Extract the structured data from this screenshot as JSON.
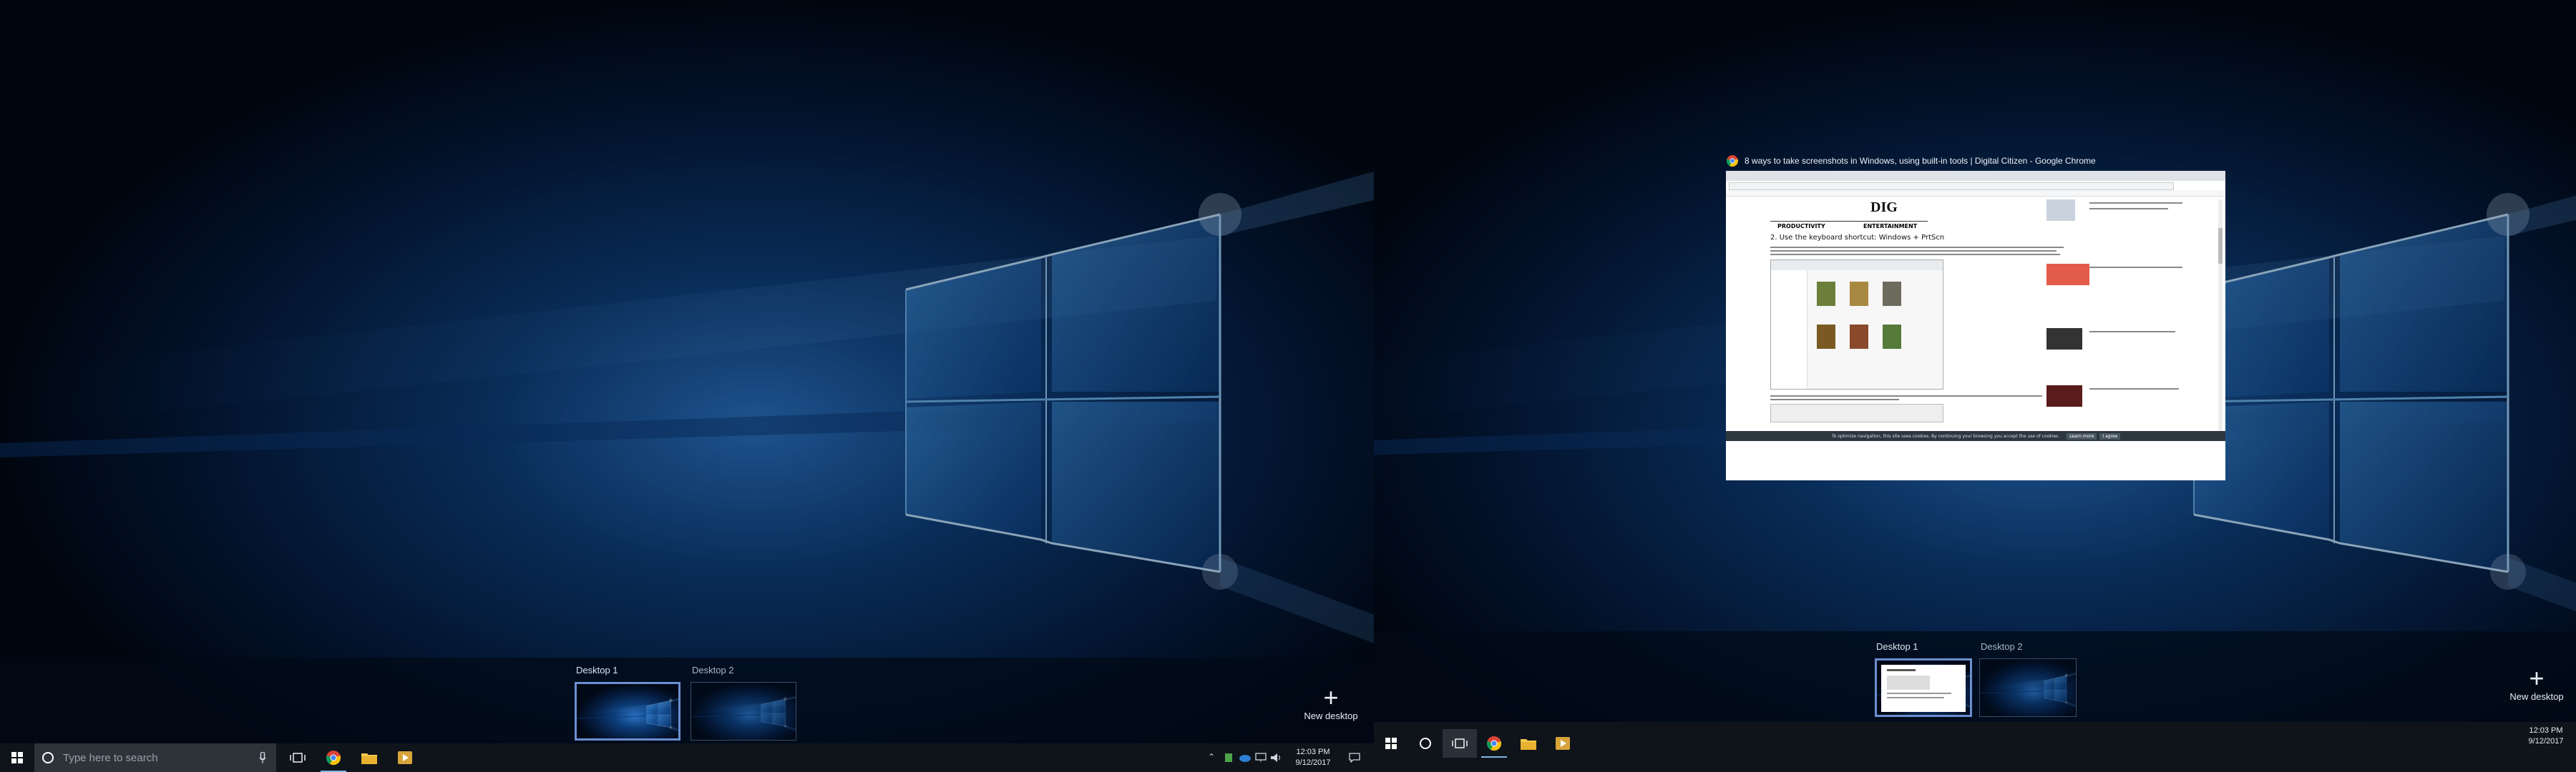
{
  "left_monitor": {
    "task_view": {
      "desktops": [
        {
          "label": "Desktop 1",
          "active": true
        },
        {
          "label": "Desktop 2",
          "active": false
        }
      ],
      "new_desktop_label": "New desktop"
    },
    "taskbar": {
      "search_placeholder": "Type here to search",
      "pinned_apps": [
        "windows-icon",
        "search-icon",
        "task-view-icon",
        "chrome-icon",
        "file-explorer-icon",
        "media-player-icon"
      ],
      "clock": {
        "time": "12:03 PM",
        "date": "9/12/2017"
      }
    }
  },
  "right_monitor": {
    "window_preview": {
      "title": "8 ways to take screenshots in Windows, using built-in tools | Digital Citizen - Google Chrome",
      "page_heading": "2. Use the keyboard shortcut: Windows + PrtScn",
      "nav_items": [
        "PRODUCTIVITY",
        "ENTERTAINMENT"
      ],
      "logo_text": "DIG",
      "cookie_bar": "To optimize navigation, this site uses cookies. By continuing your browsing you accept the use of cookies.",
      "cookie_buttons": [
        "Learn more",
        "I agree"
      ]
    },
    "task_view": {
      "desktops": [
        {
          "label": "Desktop 1",
          "active": true
        },
        {
          "label": "Desktop 2",
          "active": false
        }
      ],
      "new_desktop_label": "New desktop"
    },
    "taskbar": {
      "pinned_apps": [
        "windows-icon",
        "cortana-icon",
        "task-view-icon",
        "chrome-icon",
        "file-explorer-icon",
        "media-player-icon"
      ],
      "clock": {
        "time": "12:03 PM",
        "date": "9/12/2017"
      }
    }
  },
  "colors": {
    "wallpaper_dark": "#010a1a",
    "wallpaper_light": "#4a9fe8",
    "taskbar": "#0f141b",
    "active_border": "#6b8fd1"
  }
}
